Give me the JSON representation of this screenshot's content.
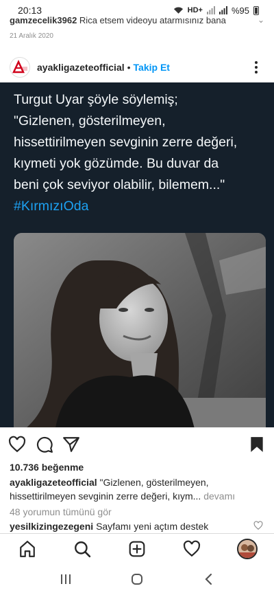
{
  "status_bar": {
    "time": "20:13",
    "network": "HD+",
    "battery": "%95"
  },
  "previous_comment": {
    "username": "gamzecelik3962",
    "text": "Rica etsem videoyu atarmısınız bana",
    "date": "21 Aralık 2020"
  },
  "post": {
    "username": "ayakligazeteofficial",
    "separator": "•",
    "follow_label": "Takip Et",
    "quote_lines": [
      "Turgut Uyar şöyle söylemiş;",
      "\"Gizlenen, gösterilmeyen,",
      "hissettirilmeyen sevginin zerre değeri,",
      "kıymeti yok gözümde. Bu duvar da",
      "beni çok seviyor olabilir, bilemem...\""
    ],
    "hashtag": "#KırmızıOda",
    "likes": "10.736 beğenme",
    "caption_user": "ayakligazeteofficial",
    "caption_text": "\"Gizlenen, gösterilmeyen, hissettirilmeyen sevginin zerre değeri, kıym...",
    "caption_more": "devamı",
    "view_comments": "48 yorumun tümünü gör",
    "comment_user": "yesilkizingezegeni",
    "comment_text": "Sayfamı yeni açtım destek"
  },
  "colors": {
    "link": "#0095f6",
    "media_bg": "#15202b",
    "hashtag": "#1da1f2",
    "quote_text": "#f5f8fa"
  }
}
